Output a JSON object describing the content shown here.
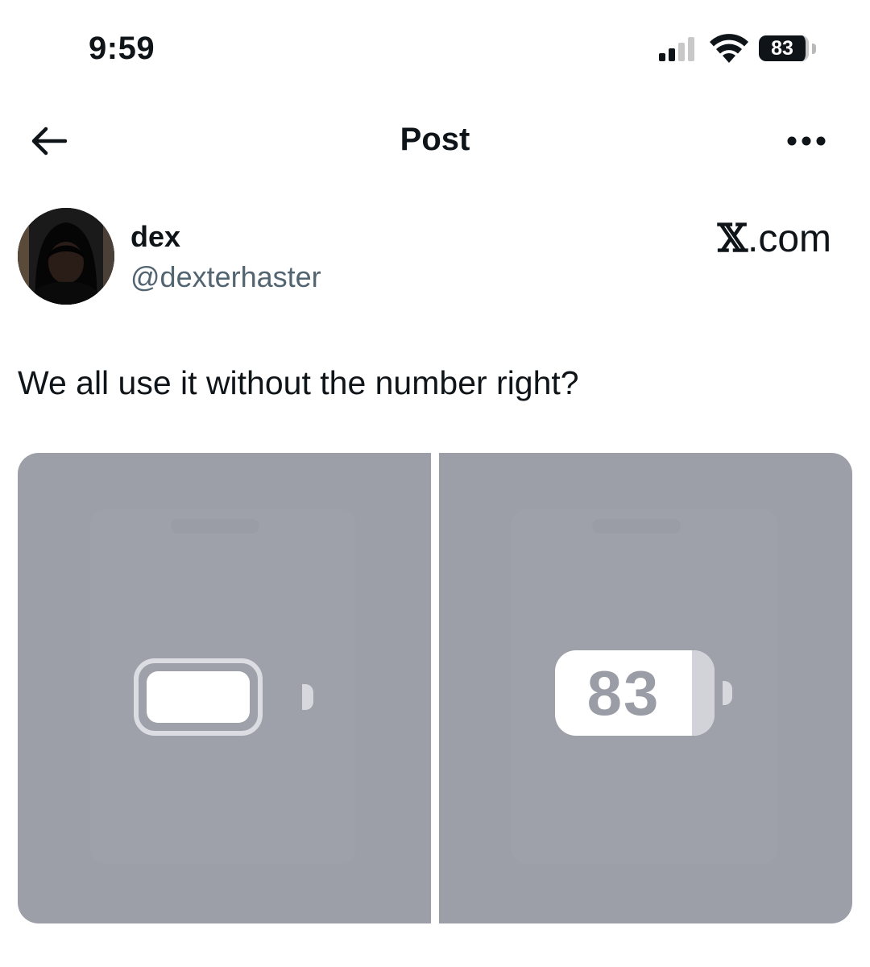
{
  "status_bar": {
    "time": "9:59",
    "battery_level": "83",
    "signal_icon": "signal-icon",
    "wifi_icon": "wifi-icon"
  },
  "header": {
    "title": "Post",
    "back_icon": "arrow-left-icon",
    "more_icon": "more-horizontal-icon"
  },
  "post": {
    "author": {
      "display_name": "dex",
      "handle": "@dexterhaster"
    },
    "watermark": {
      "x_glyph": "𝕏",
      "rest": ".com"
    },
    "text": "We all use it without the number right?",
    "media": [
      {
        "battery_style": "outline, no number",
        "battery_level": 1.0
      },
      {
        "battery_style": "number inside",
        "battery_label": "83",
        "battery_level": 0.83
      }
    ]
  },
  "colors": {
    "text": "#0f1419",
    "muted": "#536471",
    "media_bg": "#9c9ea8",
    "battery_number": "#9a9ca6"
  }
}
